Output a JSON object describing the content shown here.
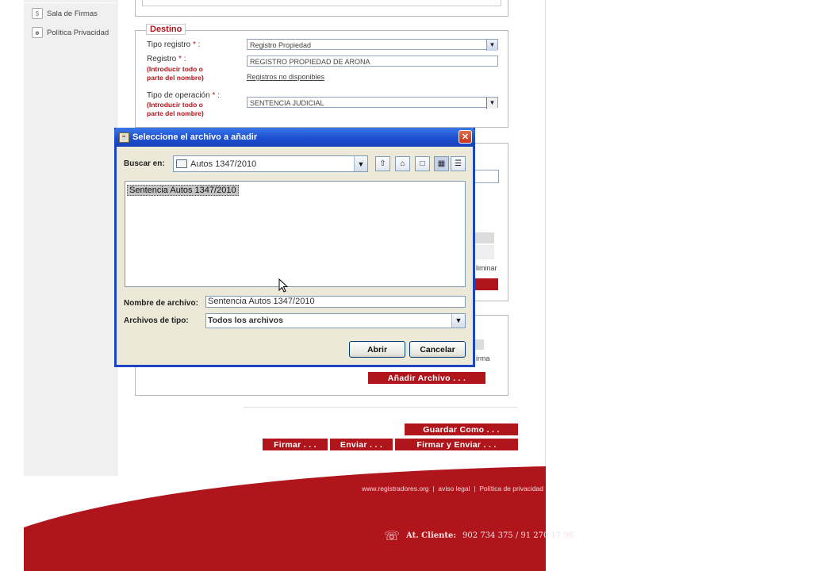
{
  "sidebar": {
    "items": [
      {
        "label": "Sala de Firmas",
        "icon": "document-dollar-icon"
      },
      {
        "label": "Política Privacidad",
        "icon": "person-icon"
      }
    ]
  },
  "destino": {
    "legend": "Destino",
    "tipo_registro": {
      "label": "Tipo registro",
      "req": "* :",
      "value": "Registro Propiedad"
    },
    "registro": {
      "label": "Registro",
      "req": "* :",
      "hint1": "(Introducir todo o",
      "hint2": "parte del nombre)",
      "value": "REGISTRO PROPIEDAD DE ARONA",
      "link": "Registros no disponibles"
    },
    "tipo_operacion": {
      "label": "Tipo de operación",
      "req": "* :",
      "hint1": "(Introducir todo o",
      "hint2": "parte del nombre)",
      "value": "SENTENCIA JUDICIAL"
    }
  },
  "background_snippets": {
    "eliminar": "liminar",
    "firma": "irma"
  },
  "buttons": {
    "anadir_archivo": "Añadir Archivo . . .",
    "guardar_como": "Guardar Como . . .",
    "firmar": "Firmar . . .",
    "enviar": "Enviar . . .",
    "firmar_y_enviar": "Firmar y Enviar . . ."
  },
  "footer": {
    "link1": "www.registradores.org",
    "sep": "|",
    "link2": "aviso legal",
    "link3": "Política de privacidad",
    "phone_label": "At. Cliente:",
    "phone_numbers": "902 734 375 / 91 270 17 96"
  },
  "dialog": {
    "title": "Seleccione el archivo a añadir",
    "look_in_label": "Buscar en:",
    "look_in_value": "Autos 1347/2010",
    "files": [
      "Sentencia Autos 1347/2010"
    ],
    "filename_label": "Nombre de archivo:",
    "filename_value": "Sentencia Autos 1347/2010",
    "filetype_label": "Archivos de tipo:",
    "filetype_value": "Todos los archivos",
    "open_button": "Abrir",
    "cancel_button": "Cancelar"
  },
  "colors": {
    "brand_red": "#b0151c",
    "dialog_blue": "#1a46c4"
  }
}
